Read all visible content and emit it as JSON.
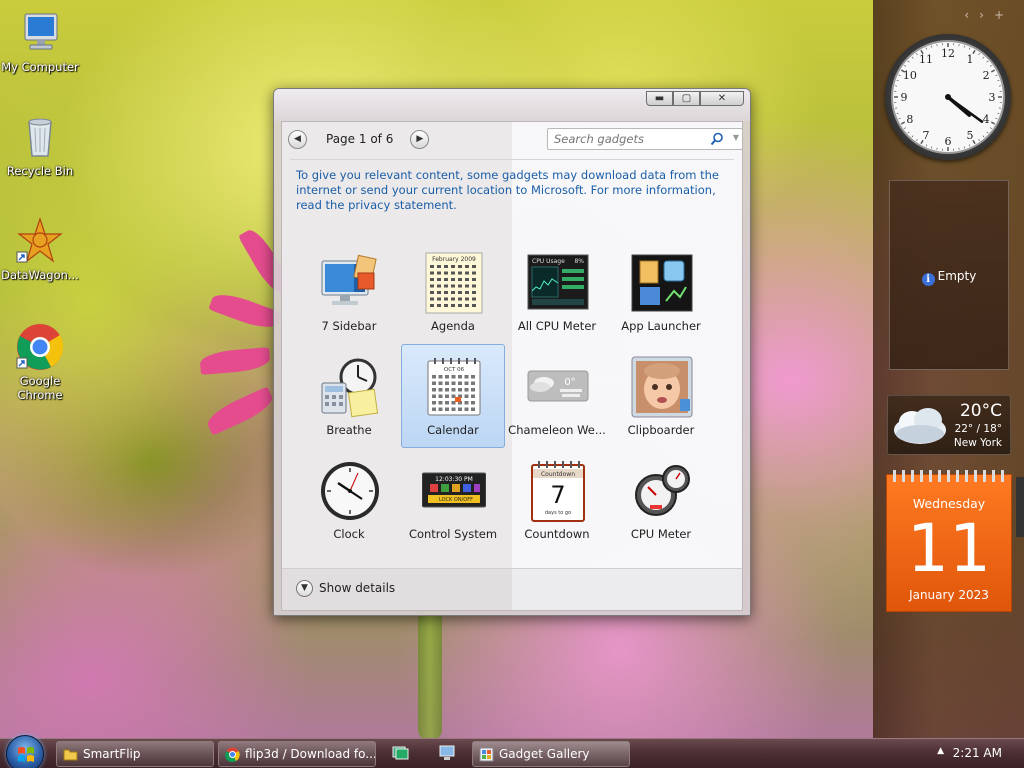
{
  "desktop": {
    "icons": [
      {
        "label": "My Computer",
        "icon": "computer-icon"
      },
      {
        "label": "Recycle Bin",
        "icon": "recycle-bin-icon"
      },
      {
        "label": "DataWagon...",
        "icon": "datawagon-icon"
      },
      {
        "label": "Google Chrome",
        "icon": "chrome-icon"
      }
    ]
  },
  "sidebar": {
    "empty_label": "Empty",
    "weather": {
      "temp": "20°C",
      "range": "22° / 18°",
      "city": "New York"
    },
    "calendar": {
      "weekday": "Wednesday",
      "day": "11",
      "month": "January 2023"
    },
    "clock_hands": {
      "hour": 4,
      "minute": 21
    }
  },
  "gallery": {
    "page_label": "Page 1 of 6",
    "search_placeholder": "Search gadgets",
    "privacy_text": "To give you relevant content, some gadgets may download data from the internet or send your current location to Microsoft. For more information, read the privacy statement.",
    "gadgets": [
      {
        "label": "7 Sidebar",
        "icon": "sidebar-icon"
      },
      {
        "label": "Agenda",
        "icon": "agenda-icon"
      },
      {
        "label": "All CPU Meter",
        "icon": "cpu-meter-screen-icon"
      },
      {
        "label": "App Launcher",
        "icon": "app-launcher-icon"
      },
      {
        "label": "Breathe",
        "icon": "breathe-icon"
      },
      {
        "label": "Calendar",
        "icon": "calendar-icon",
        "selected": true
      },
      {
        "label": "Chameleon We...",
        "icon": "chameleon-weather-icon"
      },
      {
        "label": "Clipboarder",
        "icon": "clipboarder-icon"
      },
      {
        "label": "Clock",
        "icon": "clock-icon"
      },
      {
        "label": "Control System",
        "icon": "control-system-icon"
      },
      {
        "label": "Countdown",
        "icon": "countdown-icon"
      },
      {
        "label": "CPU Meter",
        "icon": "cpu-meter-icon"
      }
    ],
    "show_details": "Show details",
    "thumb_text": {
      "agenda_month": "February 2009",
      "cpu_usage": "CPU Usage",
      "cpu_pct": "8%",
      "cal_month": "OCT 06",
      "chameleon_temp": "0°",
      "control_time": "12:03:30 PM",
      "control_lock": "LOCK ON/OFF",
      "countdown_title": "Countdown",
      "countdown_num": "7",
      "countdown_sub": "days to go"
    }
  },
  "taskbar": {
    "buttons": [
      {
        "label": "SmartFlip",
        "icon": "folder-icon"
      },
      {
        "label": "flip3d / Download fo...",
        "icon": "chrome-icon"
      },
      {
        "label": "Gadget Gallery",
        "icon": "gadget-gallery-icon"
      }
    ],
    "clock": "2:21 AM"
  }
}
